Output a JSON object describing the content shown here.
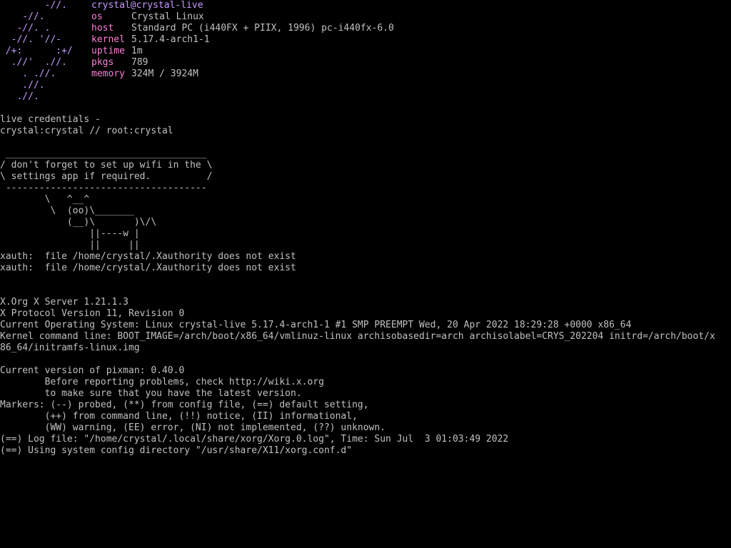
{
  "fetch": {
    "title": "crystal@crystal-live",
    "logo_lines": [
      "    -//.",
      "   -//. .",
      "  -//. '//-",
      " /+:      :+/",
      "  .//'  .//.",
      "    . .//.",
      "    .//.",
      "   .//."
    ],
    "logo_top": "        -//.",
    "rows": [
      {
        "label": "os",
        "value": "Crystal Linux"
      },
      {
        "label": "host",
        "value": "Standard PC (i440FX + PIIX, 1996) pc-i440fx-6.0"
      },
      {
        "label": "kernel",
        "value": "5.17.4-arch1-1"
      },
      {
        "label": "uptime",
        "value": "1m"
      },
      {
        "label": "pkgs",
        "value": "789"
      },
      {
        "label": "memory",
        "value": "324M / 3924M"
      }
    ],
    "colors": {
      "logo": "#c79bff",
      "title": "#c79bff",
      "labels": "#ff7fd8",
      "text": "#c0c0c0",
      "background": "#000000"
    }
  },
  "credentials": {
    "line1": "live credentials -",
    "line2": "crystal:crystal // root:crystal"
  },
  "cowsay": {
    "lines": [
      " ____________________________________",
      "/ don't forget to set up wifi in the \\",
      "\\ settings app if required.          /",
      " ------------------------------------",
      "        \\   ^__^",
      "         \\  (oo)\\_______",
      "            (__)\\       )\\/\\",
      "                ||----w |",
      "                ||     ||"
    ]
  },
  "xauth": {
    "lines": [
      "xauth:  file /home/crystal/.Xauthority does not exist",
      "xauth:  file /home/crystal/.Xauthority does not exist"
    ]
  },
  "xorg": {
    "lines": [
      "X.Org X Server 1.21.1.3",
      "X Protocol Version 11, Revision 0",
      "Current Operating System: Linux crystal-live 5.17.4-arch1-1 #1 SMP PREEMPT Wed, 20 Apr 2022 18:29:28 +0000 x86_64",
      "Kernel command line: BOOT_IMAGE=/arch/boot/x86_64/vmlinuz-linux archisobasedir=arch archisolabel=CRYS_202204 initrd=/arch/boot/x",
      "86_64/initramfs-linux.img",
      "",
      "Current version of pixman: 0.40.0",
      "        Before reporting problems, check http://wiki.x.org",
      "        to make sure that you have the latest version.",
      "Markers: (--) probed, (**) from config file, (==) default setting,",
      "        (++) from command line, (!!) notice, (II) informational,",
      "        (WW) warning, (EE) error, (NI) not implemented, (??) unknown.",
      "(==) Log file: \"/home/crystal/.local/share/xorg/Xorg.0.log\", Time: Sun Jul  3 01:03:49 2022",
      "(==) Using system config directory \"/usr/share/X11/xorg.conf.d\""
    ]
  }
}
